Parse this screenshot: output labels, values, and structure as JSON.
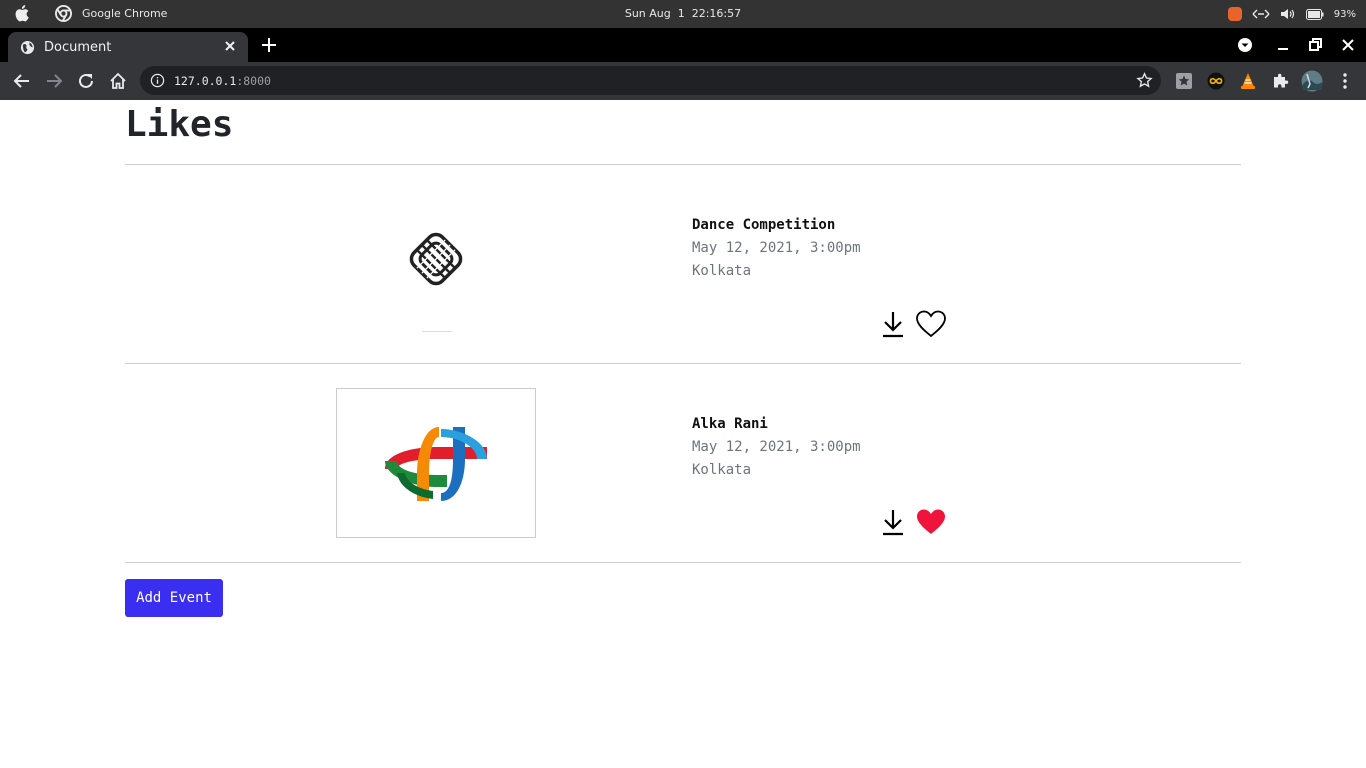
{
  "os": {
    "app_name": "Google Chrome",
    "clock": "Sun Aug  1  22:16:57",
    "battery": "93%"
  },
  "browser": {
    "tab_title": "Document",
    "url_host": "127.0.0.1",
    "url_port": ":8000"
  },
  "page": {
    "heading": "Likes",
    "events": [
      {
        "name": "Dance Competition",
        "date": "May 12, 2021, 3:00pm",
        "location": "Kolkata",
        "liked": false
      },
      {
        "name": "Alka Rani",
        "date": "May 12, 2021, 3:00pm",
        "location": "Kolkata",
        "liked": true
      }
    ],
    "add_button": "Add Event"
  },
  "colors": {
    "accent": "#3a2ef0",
    "heart_liked": "#f0143c"
  }
}
